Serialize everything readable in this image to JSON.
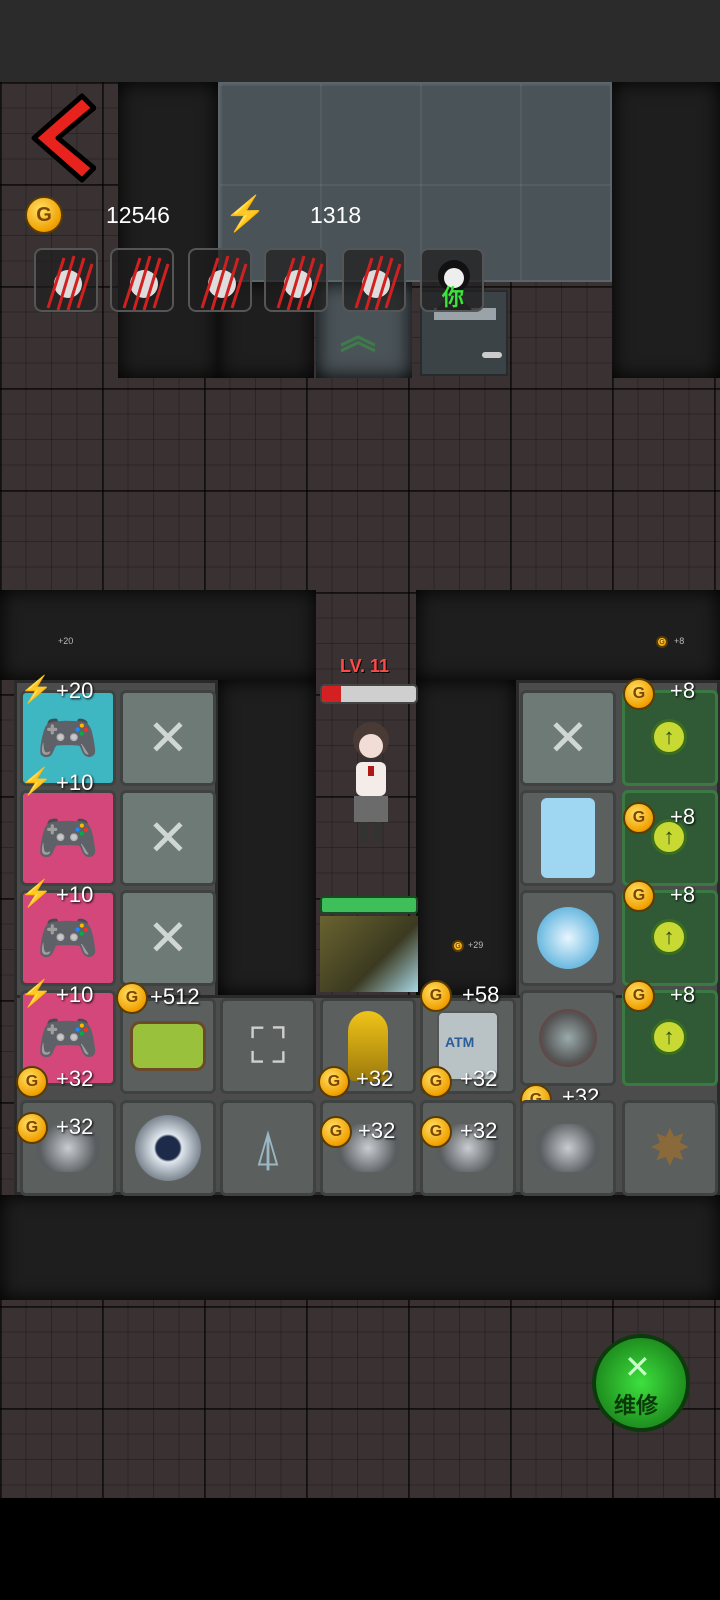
{
  "hud": {
    "gold_amount": "12546",
    "energy_amount": "1318",
    "gold_icon": "gold-coin-icon",
    "energy_icon": "lightning-icon"
  },
  "party": {
    "slots": [
      "claw-monster-icon",
      "claw-monster-icon",
      "claw-monster-icon",
      "claw-monster-icon",
      "claw-monster-icon",
      "player-avatar-icon"
    ],
    "player_label": "你"
  },
  "character": {
    "level_label": "LV. 11",
    "hp_fraction": 0.2
  },
  "coin_letter": "G",
  "left_column": {
    "badges": [
      "+20",
      "+10",
      "+10",
      "+10"
    ],
    "small_badge": "+20"
  },
  "right_column": {
    "badges": [
      "+8",
      "+8",
      "+8",
      "+8"
    ],
    "small_badge": "+8"
  },
  "door_small_badge": "+29",
  "grid_badges": {
    "bed": "+512",
    "atm_top": "+58",
    "row4_left": "+32",
    "row4_mid": "+32",
    "row4_atm": "+32",
    "row4_right": "+32",
    "row5_a": "+32",
    "row5_b": "+32",
    "row5_c": "+32"
  },
  "atm_label": "ATM",
  "repair_button": {
    "label": "维修"
  },
  "colors": {
    "accent_green": "#39e639",
    "gold": "#f0a000",
    "hp_red": "#d42020",
    "level_text": "#ff4a4a"
  }
}
